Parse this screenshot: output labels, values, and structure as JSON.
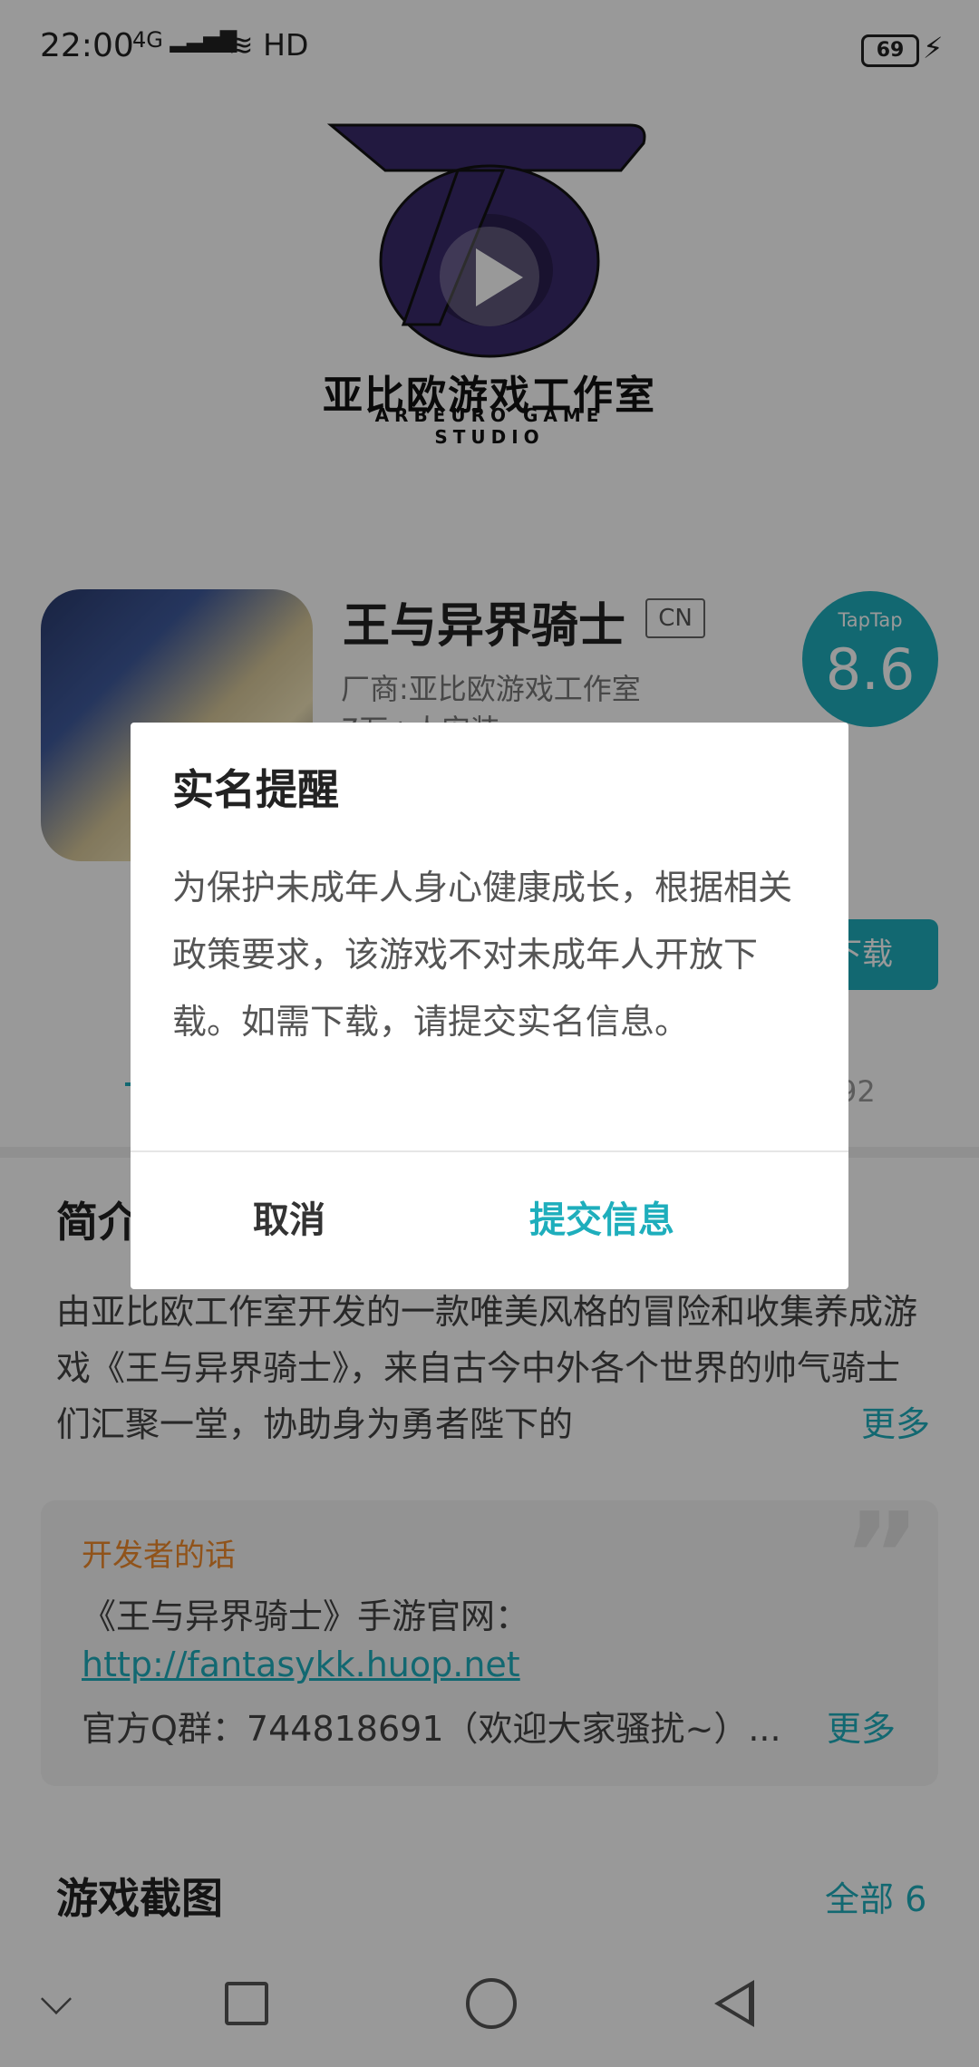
{
  "status_bar": {
    "time": "22:00",
    "network": "4G",
    "hd": "HD",
    "battery": "69"
  },
  "banner": {
    "studio_name_cn": "亚比欧游戏工作室",
    "studio_name_en": "ARBEURO GAME STUDIO",
    "play_icon": "play-icon"
  },
  "app": {
    "name": "王与异界骑士",
    "region_badge": "CN",
    "vendor": "厂商:亚比欧游戏工作室",
    "installs": "7万+人安装",
    "rating_brand": "TapTap",
    "rating_score": "8.6",
    "download_label": "下载",
    "tab_count_fragment": "92"
  },
  "intro": {
    "title": "简介",
    "text": "由亚比欧工作室开发的一款唯美风格的冒险和收集养成游戏《王与异界骑士》，来自古今中外各个世界的帅气骑士们汇聚一堂，协助身为勇者陛下的",
    "more": "更多"
  },
  "developer_note": {
    "title": "开发者的话",
    "line1": "《王与异界骑士》手游官网：",
    "link": "http://fantasykk.huop.net",
    "line3": "官方Q群：744818691（欢迎大家骚扰~）...",
    "more": "更多"
  },
  "screenshots": {
    "title": "游戏截图",
    "all_label": "全部 6"
  },
  "dialog": {
    "title": "实名提醒",
    "body": "为保护未成年人身心健康成长，根据相关政策要求，该游戏不对未成年人开放下载。如需下载，请提交实名信息。",
    "cancel_label": "取消",
    "submit_label": "提交信息"
  },
  "colors": {
    "accent": "#1eaebc",
    "developer_title": "#f08a2c",
    "logo_purple": "#3a2a6b"
  }
}
